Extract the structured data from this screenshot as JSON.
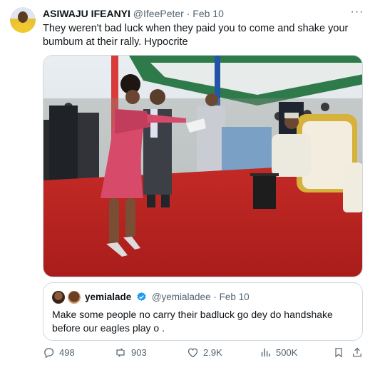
{
  "tweet": {
    "author_name": "ASIWAJU IFEANYI",
    "author_handle": "@IfeePeter",
    "separator": "·",
    "date": "Feb 10",
    "text": "They weren't bad luck when they paid you to come and shake your bumbum at their rally. Hypocrite",
    "more_icon": "more-icon"
  },
  "quoted_tweet": {
    "author_name": "yemialade",
    "verified_icon": "verified-badge-icon",
    "author_handle": "@yemialadee",
    "separator": "·",
    "date": "Feb 10",
    "text": "Make some people no carry their badluck go dey do handshake before our eagles play o ."
  },
  "actions": {
    "replies": "498",
    "reposts": "903",
    "likes": "2.9K",
    "views": "500K",
    "icons": [
      "reply-icon",
      "repost-icon",
      "like-icon",
      "views-icon",
      "bookmark-icon",
      "share-icon"
    ]
  },
  "colors": {
    "text": "#0f1419",
    "secondary": "#536471",
    "border": "#cfd9de",
    "verified": "#1d9bf0"
  }
}
